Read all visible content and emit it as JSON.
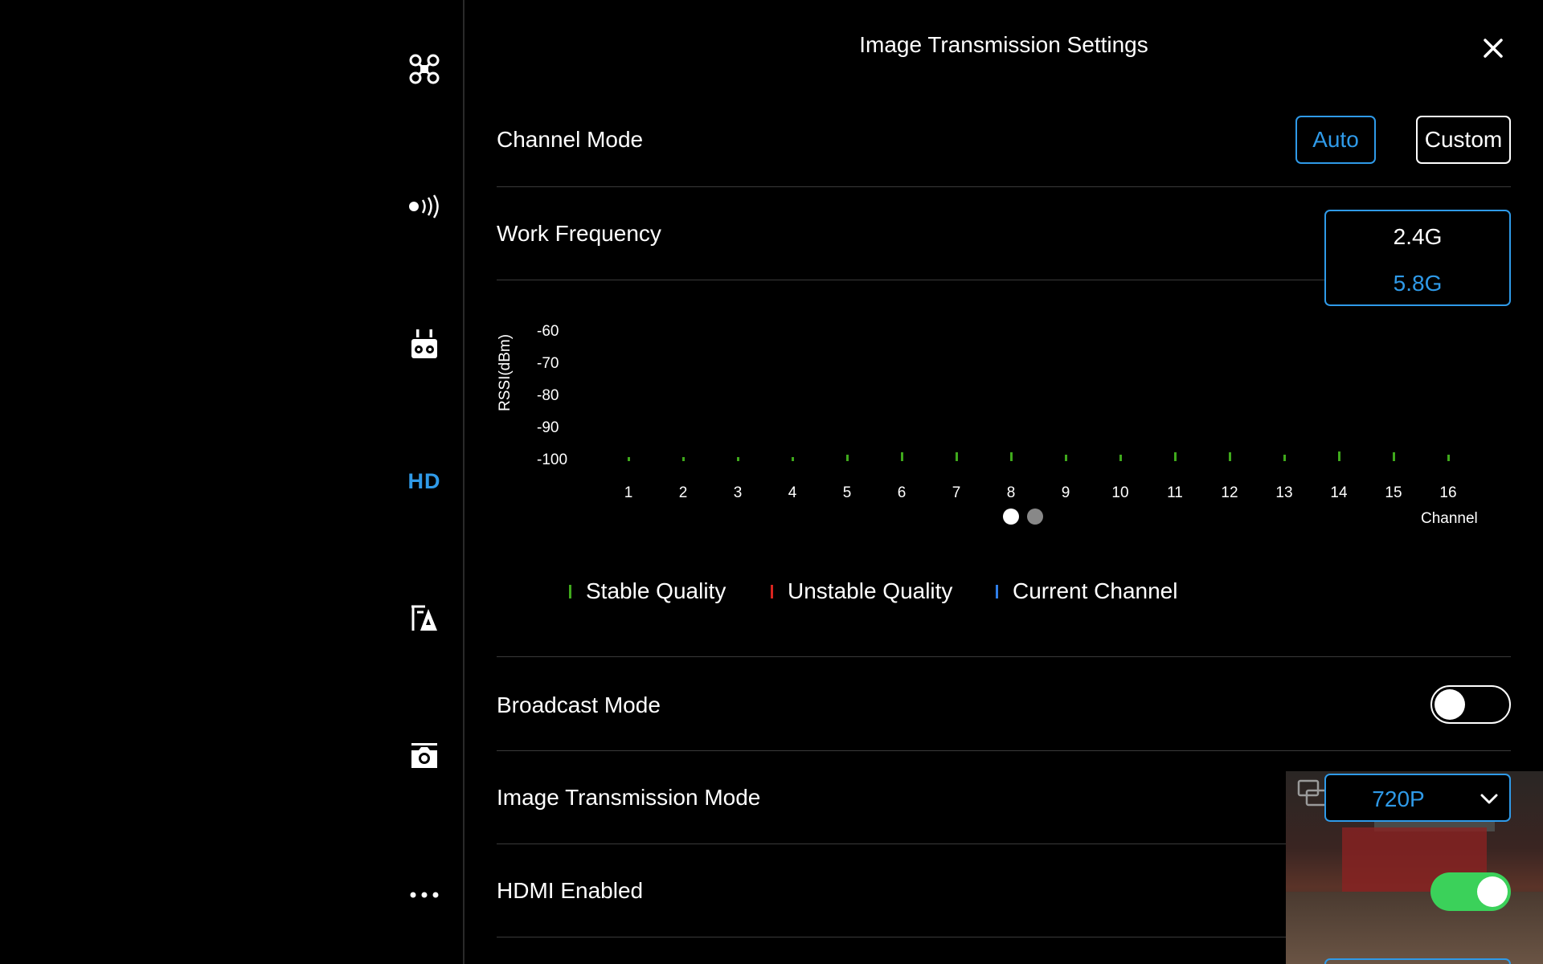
{
  "sidebar": {
    "items": [
      {
        "name": "aircraft",
        "icon": "drone-icon"
      },
      {
        "name": "sensors",
        "icon": "signal-icon"
      },
      {
        "name": "remote-controller",
        "icon": "remote-controller-icon"
      },
      {
        "name": "hd",
        "label": "HD"
      },
      {
        "name": "gimbal",
        "icon": "gimbal-icon"
      },
      {
        "name": "camera",
        "icon": "camera-icon"
      },
      {
        "name": "more",
        "icon": "more-icon"
      }
    ],
    "active_color": "#2f9ae8"
  },
  "header": {
    "title": "Image Transmission Settings"
  },
  "channel_mode": {
    "label": "Channel Mode",
    "options": [
      "Auto",
      "Custom"
    ],
    "selected": "Auto"
  },
  "work_frequency": {
    "label": "Work Frequency",
    "options": [
      "2.4G",
      "5.8G"
    ],
    "selected": "5.8G"
  },
  "chart_data": {
    "type": "bar",
    "ylabel": "RSSI(dBm)",
    "xlabel": "Channel",
    "ylim": [
      -100,
      -60
    ],
    "yticks": [
      "-60",
      "-70",
      "-80",
      "-90",
      "-100"
    ],
    "categories": [
      "1",
      "2",
      "3",
      "4",
      "5",
      "6",
      "7",
      "8",
      "9",
      "10",
      "11",
      "12",
      "13",
      "14",
      "15",
      "16"
    ],
    "values": [
      -99,
      -99,
      -99,
      -99,
      -98,
      -97,
      -97,
      -97,
      -98,
      -98,
      -97,
      -97,
      -98,
      -96.5,
      -97,
      -98
    ],
    "series_color": "#3fa91c",
    "pages": 2,
    "current_page": 1
  },
  "legend": [
    {
      "label": "Stable Quality",
      "color": "#3fa91c"
    },
    {
      "label": "Unstable Quality",
      "color": "#d8241f"
    },
    {
      "label": "Current Channel",
      "color": "#2f7ee8"
    }
  ],
  "broadcast_mode": {
    "label": "Broadcast Mode",
    "enabled": false
  },
  "image_transmission_mode": {
    "label": "Image Transmission Mode",
    "value": "720P"
  },
  "hdmi": {
    "label": "HDMI Enabled",
    "enabled": true,
    "on_color": "#3bd15a"
  }
}
